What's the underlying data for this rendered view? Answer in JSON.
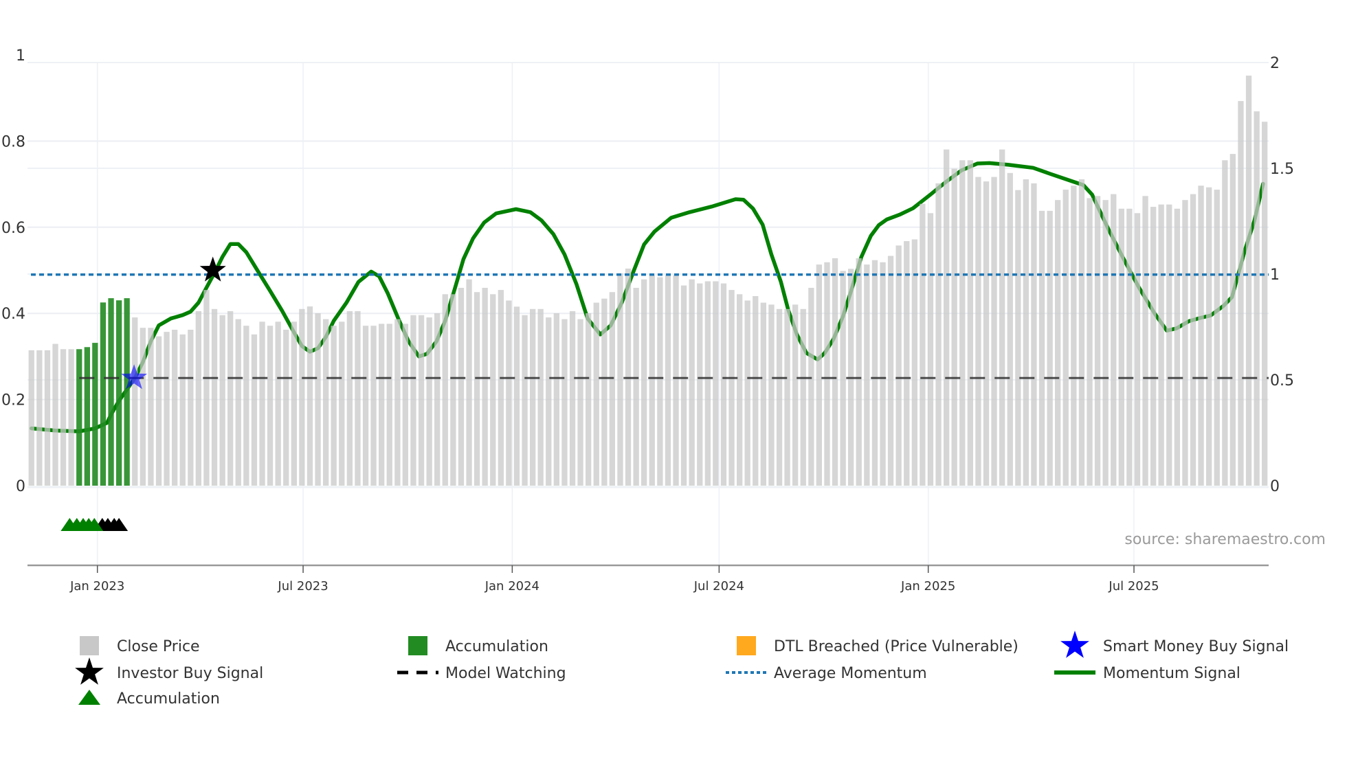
{
  "chart_data": {
    "type": "bar+line",
    "title": "",
    "x_start_date": "2022-11-04",
    "x_step_days": 7,
    "x_range": [
      "2022-10-31",
      "2025-11-04"
    ],
    "x_ticks": [
      {
        "date": "2023-01-01",
        "label": "Jan 2023"
      },
      {
        "date": "2023-07-01",
        "label": "Jul 2023"
      },
      {
        "date": "2024-01-01",
        "label": "Jan 2024"
      },
      {
        "date": "2024-07-01",
        "label": "Jul 2024"
      },
      {
        "date": "2025-01-01",
        "label": "Jan 2025"
      },
      {
        "date": "2025-07-01",
        "label": "Jul 2025"
      }
    ],
    "y_left": {
      "range": [
        0,
        1
      ],
      "ticks": [
        {
          "v": 0,
          "label": "0"
        },
        {
          "v": 0.2,
          "label": "0.2"
        },
        {
          "v": 0.4,
          "label": "0.4"
        },
        {
          "v": 0.6,
          "label": "0.6"
        },
        {
          "v": 0.8,
          "label": "0.8"
        },
        {
          "v": 1,
          "label": "1"
        }
      ]
    },
    "y_right": {
      "range": [
        0,
        2
      ],
      "ticks": [
        {
          "v": 0,
          "label": "0"
        },
        {
          "v": 0.5,
          "label": "0.5"
        },
        {
          "v": 1,
          "label": "1"
        },
        {
          "v": 1.5,
          "label": "1.5"
        },
        {
          "v": 2,
          "label": "2"
        }
      ]
    },
    "close_price": [
      0.64,
      0.64,
      0.64,
      0.67,
      0.645,
      0.645,
      0.645,
      0.655,
      0.675,
      0.866,
      0.886,
      0.876,
      0.886,
      0.795,
      0.746,
      0.746,
      0.706,
      0.727,
      0.737,
      0.715,
      0.737,
      0.825,
      0.925,
      0.835,
      0.806,
      0.825,
      0.787,
      0.756,
      0.715,
      0.775,
      0.756,
      0.775,
      0.737,
      0.775,
      0.835,
      0.847,
      0.815,
      0.787,
      0.756,
      0.775,
      0.825,
      0.825,
      0.756,
      0.756,
      0.765,
      0.765,
      0.787,
      0.765,
      0.806,
      0.806,
      0.795,
      0.815,
      0.905,
      0.905,
      0.935,
      0.975,
      0.915,
      0.935,
      0.905,
      0.925,
      0.875,
      0.846,
      0.806,
      0.835,
      0.835,
      0.795,
      0.815,
      0.787,
      0.825,
      0.787,
      0.815,
      0.865,
      0.884,
      0.915,
      1.004,
      1.026,
      0.935,
      0.975,
      0.995,
      0.985,
      0.995,
      0.995,
      0.946,
      0.975,
      0.956,
      0.966,
      0.966,
      0.956,
      0.925,
      0.905,
      0.875,
      0.896,
      0.865,
      0.856,
      0.835,
      0.835,
      0.856,
      0.835,
      0.935,
      1.045,
      1.056,
      1.075,
      1.015,
      1.025,
      1.075,
      1.045,
      1.066,
      1.056,
      1.086,
      1.135,
      1.156,
      1.164,
      1.332,
      1.288,
      1.429,
      1.589,
      1.498,
      1.538,
      1.538,
      1.459,
      1.438,
      1.459,
      1.589,
      1.478,
      1.397,
      1.448,
      1.429,
      1.299,
      1.299,
      1.35,
      1.399,
      1.418,
      1.448,
      1.359,
      1.369,
      1.35,
      1.378,
      1.309,
      1.309,
      1.288,
      1.369,
      1.318,
      1.329,
      1.329,
      1.309,
      1.35,
      1.378,
      1.418,
      1.41,
      1.399,
      1.538,
      1.568,
      1.818,
      1.938,
      1.769,
      1.72
    ],
    "accumulation_weeks": [
      7,
      8,
      9,
      10,
      11,
      12,
      13
    ],
    "momentum_signal": [
      [
        1,
        0.133
      ],
      [
        4,
        0.128
      ],
      [
        7,
        0.126
      ],
      [
        9,
        0.133
      ],
      [
        10.5,
        0.146
      ],
      [
        11,
        0.165
      ],
      [
        12,
        0.197
      ],
      [
        14,
        0.25
      ],
      [
        15,
        0.287
      ],
      [
        16,
        0.335
      ],
      [
        17,
        0.372
      ],
      [
        18.5,
        0.388
      ],
      [
        20,
        0.396
      ],
      [
        21,
        0.404
      ],
      [
        22,
        0.425
      ],
      [
        23,
        0.46
      ],
      [
        24,
        0.494
      ],
      [
        25,
        0.531
      ],
      [
        26,
        0.561
      ],
      [
        27,
        0.561
      ],
      [
        28,
        0.542
      ],
      [
        29.5,
        0.497
      ],
      [
        31,
        0.452
      ],
      [
        32.5,
        0.406
      ],
      [
        34,
        0.356
      ],
      [
        35,
        0.324
      ],
      [
        36,
        0.311
      ],
      [
        37,
        0.319
      ],
      [
        38,
        0.345
      ],
      [
        39,
        0.383
      ],
      [
        40.6,
        0.425
      ],
      [
        42.1,
        0.473
      ],
      [
        43.7,
        0.497
      ],
      [
        44.7,
        0.486
      ],
      [
        45.8,
        0.446
      ],
      [
        47.1,
        0.388
      ],
      [
        48.4,
        0.335
      ],
      [
        49.7,
        0.3
      ],
      [
        50.7,
        0.306
      ],
      [
        51.9,
        0.335
      ],
      [
        53,
        0.383
      ],
      [
        54.2,
        0.457
      ],
      [
        55.3,
        0.526
      ],
      [
        56.5,
        0.574
      ],
      [
        57.9,
        0.611
      ],
      [
        59.4,
        0.632
      ],
      [
        61.9,
        0.642
      ],
      [
        63.7,
        0.635
      ],
      [
        65.1,
        0.616
      ],
      [
        66.6,
        0.584
      ],
      [
        68,
        0.537
      ],
      [
        69.5,
        0.468
      ],
      [
        70.9,
        0.388
      ],
      [
        72.5,
        0.351
      ],
      [
        73.8,
        0.372
      ],
      [
        75.2,
        0.425
      ],
      [
        76.7,
        0.499
      ],
      [
        78,
        0.56
      ],
      [
        79.3,
        0.59
      ],
      [
        81.4,
        0.622
      ],
      [
        83.7,
        0.635
      ],
      [
        86.5,
        0.648
      ],
      [
        89.5,
        0.665
      ],
      [
        90.5,
        0.664
      ],
      [
        91.7,
        0.643
      ],
      [
        92.9,
        0.606
      ],
      [
        94,
        0.537
      ],
      [
        95.2,
        0.473
      ],
      [
        96.1,
        0.409
      ],
      [
        97.2,
        0.351
      ],
      [
        98.4,
        0.308
      ],
      [
        99.8,
        0.293
      ],
      [
        100.7,
        0.308
      ],
      [
        101.8,
        0.34
      ],
      [
        103,
        0.393
      ],
      [
        104.1,
        0.457
      ],
      [
        105.3,
        0.531
      ],
      [
        106.5,
        0.58
      ],
      [
        107.5,
        0.605
      ],
      [
        108.5,
        0.618
      ],
      [
        110.1,
        0.629
      ],
      [
        111.8,
        0.644
      ],
      [
        114,
        0.676
      ],
      [
        116,
        0.706
      ],
      [
        117.9,
        0.732
      ],
      [
        119.9,
        0.748
      ],
      [
        121.4,
        0.749
      ],
      [
        123.8,
        0.745
      ],
      [
        126.9,
        0.738
      ],
      [
        129.2,
        0.723
      ],
      [
        131.6,
        0.708
      ],
      [
        133.2,
        0.698
      ],
      [
        134.3,
        0.676
      ],
      [
        136.3,
        0.598
      ],
      [
        138.2,
        0.529
      ],
      [
        140.2,
        0.46
      ],
      [
        142.2,
        0.399
      ],
      [
        143.7,
        0.36
      ],
      [
        144.9,
        0.365
      ],
      [
        146.5,
        0.382
      ],
      [
        148,
        0.39
      ],
      [
        149.2,
        0.395
      ],
      [
        150.8,
        0.417
      ],
      [
        151.9,
        0.438
      ],
      [
        153.5,
        0.546
      ],
      [
        154.7,
        0.615
      ],
      [
        155.8,
        0.701
      ]
    ],
    "average_momentum": 0.49,
    "model_watching": {
      "value": 0.25,
      "from_week": 7
    },
    "investor_buy_signal": {
      "week": 23.8,
      "value": 0.5
    },
    "smart_money_buy_signal": {
      "week": 13.9,
      "value": 0.25
    },
    "accumulation_triangles": [
      5.8,
      6.7,
      7.5,
      8.2,
      8.9
    ],
    "black_triangles": [
      9.9,
      10.6,
      11.4,
      12.0
    ],
    "legend_placement": "bottom",
    "grid": true
  },
  "colors": {
    "close_price": "#c8c8c8",
    "accumulation": "#228b22",
    "dtl_breached": "#ffa91f",
    "smart_money": "#0000ff",
    "investor": "#000000",
    "model_watching": "#333333",
    "average_momentum": "#1f77b4",
    "momentum": "#008000"
  },
  "legend": [
    {
      "key": "close_price",
      "label": "Close Price",
      "icon": "square"
    },
    {
      "key": "accumulation",
      "label": "Accumulation",
      "icon": "square"
    },
    {
      "key": "dtl_breached",
      "label": "DTL Breached (Price Vulnerable)",
      "icon": "square"
    },
    {
      "key": "smart_money",
      "label": "Smart Money Buy Signal",
      "icon": "star"
    },
    {
      "key": "investor",
      "label": "Investor Buy Signal",
      "icon": "star"
    },
    {
      "key": "model_watching",
      "label": "Model Watching",
      "icon": "dash"
    },
    {
      "key": "average_momentum",
      "label": "Average Momentum",
      "icon": "dot"
    },
    {
      "key": "momentum",
      "label": "Momentum Signal",
      "icon": "line"
    },
    {
      "key": "accumulation",
      "label": "Accumulation",
      "icon": "triangle"
    }
  ],
  "source": "source: sharemaestro.com"
}
